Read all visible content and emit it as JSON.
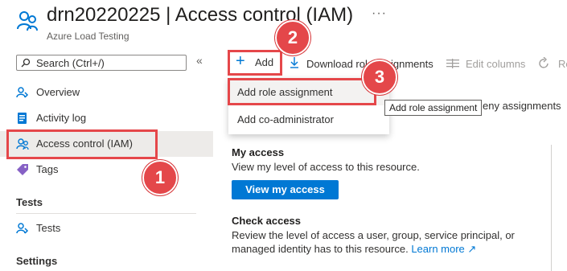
{
  "header": {
    "title": "drn20220225 | Access control (IAM)",
    "subtitle": "Azure Load Testing",
    "more": "···"
  },
  "sidebar": {
    "search_placeholder": "Search (Ctrl+/)",
    "collapse": "«",
    "items": [
      {
        "label": "Overview",
        "icon": "overview-icon"
      },
      {
        "label": "Activity log",
        "icon": "activity-log-icon"
      },
      {
        "label": "Access control (IAM)",
        "icon": "iam-icon",
        "selected": true
      },
      {
        "label": "Tags",
        "icon": "tag-icon"
      }
    ],
    "sections": [
      {
        "title": "Tests",
        "items": [
          {
            "label": "Tests",
            "icon": "tests-icon"
          }
        ]
      },
      {
        "title": "Settings",
        "items": []
      }
    ]
  },
  "toolbar": {
    "add": "Add",
    "download": "Download role assignments",
    "download_visible": "Download rol",
    "download_tail": "ssignments",
    "edit_columns": "Edit columns",
    "refresh": "Re"
  },
  "dropdown": {
    "items": [
      "Add role assignment",
      "Add co-administrator"
    ],
    "tooltip": "Add role assignment"
  },
  "tab_fragment": "eny assignments",
  "content": {
    "my_access": {
      "title": "My access",
      "desc": "View my level of access to this resource.",
      "button": "View my access"
    },
    "check_access": {
      "title": "Check access",
      "desc_line1": "Review the level of access a user, group, service principal, or",
      "desc_line2": "managed identity has to this resource.",
      "link": "Learn more"
    }
  },
  "callouts": [
    "1",
    "2",
    "3"
  ],
  "colors": {
    "accent": "#0078d4",
    "callout": "#e5474a",
    "selected_bg": "#edebe9"
  }
}
